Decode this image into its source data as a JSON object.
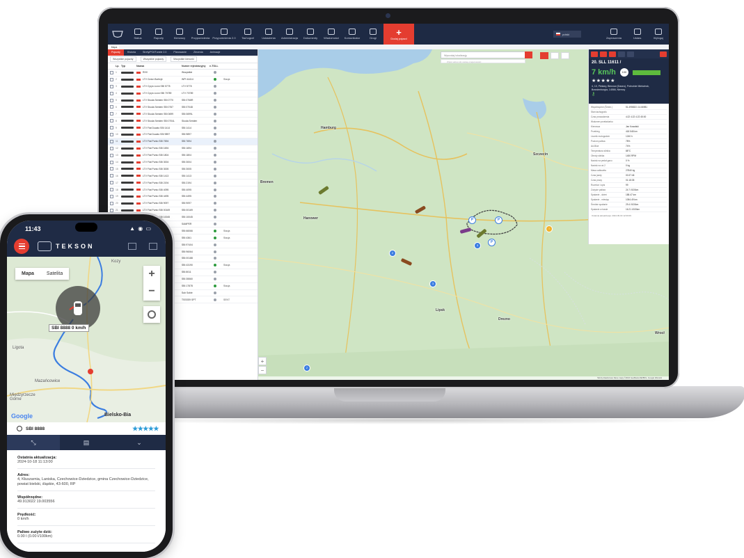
{
  "laptop": {
    "topnav": {
      "items": [
        "Status",
        "Raporty",
        "Kierowcy",
        "Przypomnienia",
        "Przypomnienia 2.0",
        "Tachograf",
        "Ustawienia",
        "Administracja",
        "Dokumenty",
        "Wiadomości",
        "Komunikator",
        "Drogi"
      ],
      "add_label": "Dodaj pojazd",
      "lang": "polski",
      "right_items": [
        "Zaproszenia",
        "Ustaw.",
        "Wyloguj"
      ]
    },
    "subtab": "Mapa",
    "left_panel": {
      "tabs": [
        "Pojazdy",
        "Historia",
        "Strefy/POI/Tunele 2.0",
        "Planowanie",
        "Zlecenia",
        "Animacje"
      ],
      "filters": [
        "Wszystkie pojazdy",
        "Wszystkie pojazdy",
        "Wszystkie kierunki"
      ],
      "columns": [
        "Lp.",
        "Typ",
        "Nazwa",
        "Numer rejestracyjny",
        "e-TOLL"
      ],
      "rows": [
        {
          "n": "1",
          "name": "RHV",
          "plate": "Wszystkie",
          "status": "SENT",
          "extra": ""
        },
        {
          "n": "2",
          "name": "LTV Cizion Boritcje",
          "plate": "WPI 44414",
          "status": "green",
          "extra": "Stacja"
        },
        {
          "n": "3",
          "name": "LTV Cyrys Lizon SBI 5778",
          "plate": "LTV 5778",
          "status": "gray",
          "extra": ""
        },
        {
          "n": "4",
          "name": "LTV Cyrys Lizon SBI 70789",
          "plate": "LTV 70789",
          "status": "gray",
          "extra": ""
        },
        {
          "n": "5",
          "name": "LTV Skoda Seriden SBI 0770",
          "plate": "SBI 0768R",
          "status": "gray",
          "extra": ""
        },
        {
          "n": "6",
          "name": "LTV Skoda Seriden SBI 0767",
          "plate": "SBI 07048",
          "status": "gray",
          "extra": ""
        },
        {
          "n": "7",
          "name": "LTV Skoda Seriden SBI 0699",
          "plate": "SBI 0699L",
          "status": "gray",
          "extra": ""
        },
        {
          "n": "8",
          "name": "LTV Skoda Seriden SBI 0704L",
          "plate": "Skoda Seriden",
          "status": "gray",
          "extra": ""
        },
        {
          "n": "9",
          "name": "LTV Fiat Ducato SBI 1414",
          "plate": "SBI 1414",
          "status": "gray",
          "extra": ""
        },
        {
          "n": "10",
          "name": "LTV Fiat Ducato SBI 9897",
          "plate": "SBI 9897",
          "status": "gray",
          "extra": ""
        },
        {
          "n": "11",
          "name": "LTV Fiat Punto SBI 7694",
          "plate": "SBI 7694",
          "status": "gray",
          "extra": ""
        },
        {
          "n": "12",
          "name": "LTV Fiat Punto SBI 1694",
          "plate": "SBI 1694",
          "status": "gray",
          "extra": ""
        },
        {
          "n": "13",
          "name": "LTV Fiat Punto SBI 1804",
          "plate": "SBI 1804",
          "status": "gray",
          "extra": ""
        },
        {
          "n": "14",
          "name": "LTV Fiat Punto SBI 3004",
          "plate": "SBI 3004",
          "status": "gray",
          "extra": ""
        },
        {
          "n": "15",
          "name": "LTV Fiat Punto SBI 3005",
          "plate": "SBI 3005",
          "status": "gray",
          "extra": ""
        },
        {
          "n": "16",
          "name": "LTV Fiat Punto SBI 1413",
          "plate": "SBI 1413",
          "status": "gray",
          "extra": ""
        },
        {
          "n": "17",
          "name": "LTV Fiat Punto SBI 2194",
          "plate": "SBI 2194",
          "status": "gray",
          "extra": ""
        },
        {
          "n": "18",
          "name": "LTV Fiat Punto SBI 4095",
          "plate": "SBI 4095",
          "status": "gray",
          "extra": ""
        },
        {
          "n": "19",
          "name": "LTV Fiat Punto SBI 4495",
          "plate": "SBI 4495",
          "status": "gray",
          "extra": ""
        },
        {
          "n": "20",
          "name": "LTV Fiat Punto SBI 9097",
          "plate": "SBI 9097",
          "status": "gray",
          "extra": ""
        },
        {
          "n": "21",
          "name": "LTV Fiat Punto SBI 00169",
          "plate": "SBI 00169",
          "status": "gray",
          "extra": ""
        },
        {
          "n": "22",
          "name": "LTV Fiat Punto SBI 10045",
          "plate": "SBI 10045",
          "status": "gray",
          "extra": ""
        },
        {
          "n": "23",
          "name": "",
          "plate": "SAMPER",
          "status": "gray",
          "extra": ""
        },
        {
          "n": "24",
          "name": "",
          "plate": "SBI 66066",
          "status": "green",
          "extra": "Stacja"
        },
        {
          "n": "25",
          "name": "",
          "plate": "SBI 4361",
          "status": "green",
          "extra": "Stacja"
        },
        {
          "n": "26",
          "name": "",
          "plate": "SBI 97404",
          "status": "gray",
          "extra": ""
        },
        {
          "n": "27",
          "name": "",
          "plate": "SBI 96064",
          "status": "gray",
          "extra": ""
        },
        {
          "n": "28",
          "name": "",
          "plate": "SBI 00188",
          "status": "gray",
          "extra": ""
        },
        {
          "n": "29",
          "name": "",
          "plate": "SBI 43190",
          "status": "green",
          "extra": "Stacja"
        },
        {
          "n": "30",
          "name": "",
          "plate": "SBI 8011",
          "status": "gray",
          "extra": ""
        },
        {
          "n": "31",
          "name": "",
          "plate": "SBI 35560",
          "status": "gray",
          "extra": ""
        },
        {
          "n": "32",
          "name": "",
          "plate": "SBI 17878",
          "status": "green",
          "extra": "Stacja"
        },
        {
          "n": "33",
          "name": "",
          "plate": "Sub Sobie",
          "status": "gray",
          "extra": ""
        },
        {
          "n": "34",
          "name": "",
          "plate": "TSSSS9 SPT",
          "status": "gray",
          "extra": "SENT"
        }
      ]
    },
    "map": {
      "search_placeholder": "Wyszukaj lokalizację",
      "search_sub": "Wpisz adres lub nazwę miejscowości",
      "cities": [
        "Hamburg",
        "Szczecin",
        "Hanower",
        "Bremen",
        "Lipsk",
        "Drezno",
        "Wrocł"
      ],
      "footer": "Skróty klawiszowe  Dane mapy ©2024 GeoBasis-DE/BKG, Google  Warunki"
    },
    "detail": {
      "title": "20. SLL 11611 /",
      "speed": "7 km/h",
      "badge": "100",
      "stars": "★★★★★",
      "address": "4, 10, Piekary, Bierzow (Daseu), Poleutnie Miekzinsk, Brandenburgia, 14566, Niemcy",
      "rows": [
        [
          "Współrzędne (Średn.)",
          "51.4958321 14.66981"
        ],
        [
          "Stan tachografu",
          ""
        ],
        [
          "Czas prowadzenia",
          "4:22  4:22  4:22  45:00"
        ],
        [
          "Wolumen przeładunku",
          ""
        ],
        [
          "Kierowca",
          "Jan Kowalski"
        ],
        [
          "Przebieg",
          "418 548 km"
        ],
        [
          "Licznik motogodzin",
          "1240 h"
        ],
        [
          "Poziom paliwa",
          "78%"
        ],
        [
          "Ad-Blue",
          "74%"
        ],
        [
          "Temperatura silnika",
          "88°C"
        ],
        [
          "Obroty silnika",
          "1450 RPM"
        ],
        [
          "Nacisk na pedał gazu",
          "0 %"
        ],
        [
          "Nacisk na oś 2",
          "0 kg"
        ],
        [
          "Masa całkowita",
          "27840 kg"
        ],
        [
          "Czas jazdy",
          "00:37:46"
        ],
        [
          "Czas pracy",
          "01:18:35"
        ],
        [
          "Rozmiar i opis",
          "99"
        ],
        [
          "Zużycie paliwa",
          "24.7 l/100km"
        ],
        [
          "Spalanie - dzień",
          "188.47 km"
        ],
        [
          "Spalanie - miesiąc",
          "1054.49 km"
        ],
        [
          "Średnie spalanie",
          "29.4 l/100km"
        ],
        [
          "Spalanie w trasie",
          "16.21 l/100km"
        ]
      ],
      "footer": "Ostatnia aktualizacja: 2024.09.03 12:09:09"
    }
  },
  "phone": {
    "time": "11:43",
    "status_icons": "▲ ◉ ▭",
    "brand": "TEKSON",
    "map_type": [
      "Mapa",
      "Satelita"
    ],
    "zoom_in": "+",
    "zoom_out": "−",
    "vehicle_label": "SBI 8888  0 km/h",
    "map_labels": [
      "Kozy",
      "Bielsko-Bia",
      "Międzyrzecze Górne",
      "Mazańcowice",
      "Ligota"
    ],
    "google": "Google",
    "search_value": "SBI 8888",
    "stars": "★★★★★",
    "info": [
      {
        "label": "Ostatnia aktualizacja:",
        "value": "2024-10-18 11:13:00"
      },
      {
        "label": "Adres:",
        "value": "4, Kłuszarnia, Laniska, Czechowice-Dziedzice, gmina Czechowice-Dziedzice, powiat bielski, śląskie, 43-600, RP"
      },
      {
        "label": "Współrzędne:",
        "value": "49.913022 19.003556"
      },
      {
        "label": "Prędkość:",
        "value": "0 km/h"
      },
      {
        "label": "Paliwo zużyte dziś:",
        "value": "0.00 l   (0.00 l/100km)"
      }
    ]
  },
  "colors": {
    "accent": "#e43d30",
    "navy": "#1f2b45",
    "map_green": "#cfe5c4",
    "water": "#a9cde8",
    "route": "#3b7de0"
  }
}
